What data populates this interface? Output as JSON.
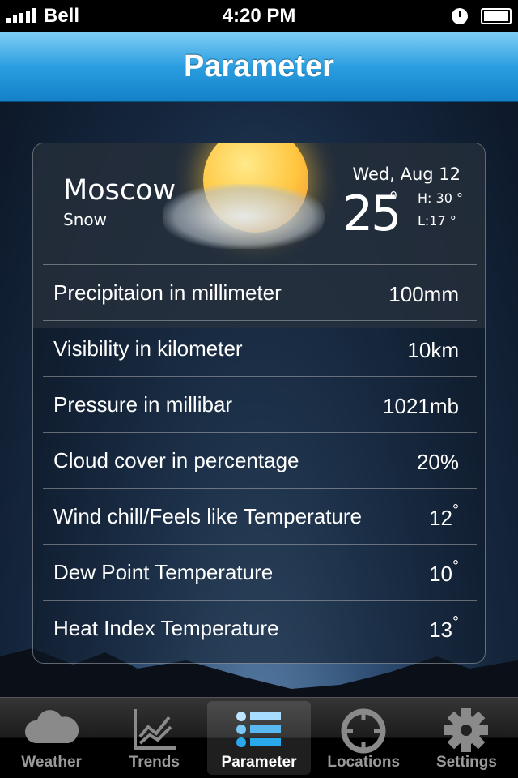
{
  "status_bar": {
    "carrier": "Bell",
    "time": "4:20 PM"
  },
  "header": {
    "title": "Parameter"
  },
  "weather": {
    "city": "Moscow",
    "condition": "Snow",
    "date": "Wed, Aug 12",
    "temperature": "25",
    "degree": "0",
    "high": "H: 30 °",
    "low": "L:17 °"
  },
  "parameters": [
    {
      "label": "Precipitaion in millimeter",
      "value": "100mm",
      "deg": ""
    },
    {
      "label": "Visibility in kilometer",
      "value": "10km",
      "deg": ""
    },
    {
      "label": "Pressure in millibar",
      "value": "1021mb",
      "deg": ""
    },
    {
      "label": "Cloud cover in percentage",
      "value": "20%",
      "deg": ""
    },
    {
      "label": "Wind chill/Feels like Temperature",
      "value": "12",
      "deg": "°"
    },
    {
      "label": "Dew Point Temperature",
      "value": "10",
      "deg": "°"
    },
    {
      "label": "Heat Index Temperature",
      "value": "13",
      "deg": "°"
    }
  ],
  "tabs": [
    {
      "label": "Weather",
      "icon": "cloud-icon"
    },
    {
      "label": "Trends",
      "icon": "chart-icon"
    },
    {
      "label": "Parameter",
      "icon": "list-icon",
      "active": true
    },
    {
      "label": "Locations",
      "icon": "crosshair-icon"
    },
    {
      "label": "Settings",
      "icon": "gear-icon"
    }
  ],
  "colors": {
    "header": "#2a9ee0",
    "active_tab_icon": "#29a8ec"
  }
}
